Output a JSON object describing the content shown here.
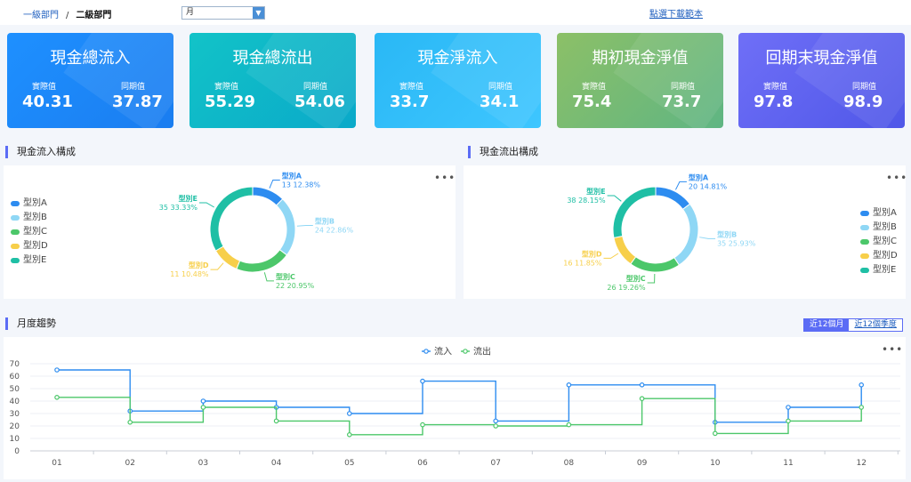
{
  "breadcrumb": {
    "level1": "一級部門",
    "separator": "/",
    "level2": "二級部門"
  },
  "period_select": {
    "value": "月"
  },
  "download_link": "點選下載範本",
  "kpis": [
    {
      "title": "現金總流入",
      "actual_label": "實際值",
      "actual": "40.31",
      "prior_label": "同期值",
      "prior": "37.87",
      "color_from": "#1e90ff",
      "color_to": "#1a7df0"
    },
    {
      "title": "現金總流出",
      "actual_label": "實際值",
      "actual": "55.29",
      "prior_label": "同期值",
      "prior": "54.06",
      "color_from": "#12c3c8",
      "color_to": "#0aa9c9"
    },
    {
      "title": "現金淨流入",
      "actual_label": "實際值",
      "actual": "33.7",
      "prior_label": "同期值",
      "prior": "34.1",
      "color_from": "#2ab8f5",
      "color_to": "#3ec6ff"
    },
    {
      "title": "期初現金淨值",
      "actual_label": "實際值",
      "actual": "75.4",
      "prior_label": "同期值",
      "prior": "73.7",
      "color_from": "#8cc067",
      "color_to": "#5fb583"
    },
    {
      "title": "回期末現金淨值",
      "actual_label": "實際值",
      "actual": "97.8",
      "prior_label": "同期值",
      "prior": "98.9",
      "color_from": "#6f6ff7",
      "color_to": "#4f57e8"
    }
  ],
  "sections": {
    "inflow": "現金流入構成",
    "outflow": "現金流出構成",
    "trend": "月度趨勢"
  },
  "period_tabs": [
    "近12個月",
    "近12個季度"
  ],
  "category_colors": [
    "#2d8cf0",
    "#8fd7f5",
    "#4cc76a",
    "#f7cf4a",
    "#1fbfa5"
  ],
  "chart_data": [
    {
      "type": "pie",
      "id": "inflow",
      "categories": [
        "型別A",
        "型別B",
        "型別C",
        "型別D",
        "型別E"
      ],
      "values": [
        13,
        24,
        22,
        11,
        35
      ],
      "percent_labels": [
        "12.38%",
        "22.86%",
        "20.95%",
        "10.48%",
        "33.33%"
      ],
      "legend_placement": "left"
    },
    {
      "type": "pie",
      "id": "outflow",
      "categories": [
        "型別A",
        "型別B",
        "型別C",
        "型別D",
        "型別E"
      ],
      "values": [
        20,
        35,
        26,
        16,
        38
      ],
      "percent_labels": [
        "14.81%",
        "25.93%",
        "19.26%",
        "11.85%",
        "28.15%"
      ],
      "legend_placement": "right"
    },
    {
      "type": "line",
      "id": "trend",
      "step": true,
      "categories": [
        "01",
        "02",
        "03",
        "04",
        "05",
        "06",
        "07",
        "08",
        "09",
        "10",
        "11",
        "12"
      ],
      "ylim": [
        0,
        70
      ],
      "yticks": [
        0,
        10,
        20,
        30,
        40,
        50,
        60,
        70
      ],
      "legend_placement": "top",
      "series": [
        {
          "name": "流入",
          "color": "#2d8cf0",
          "values": [
            65,
            32,
            40,
            35,
            30,
            56,
            24,
            53,
            53,
            23,
            35,
            53
          ],
          "end_value": 35
        },
        {
          "name": "流出",
          "color": "#4cc76a",
          "values": [
            43,
            23,
            35,
            24,
            13,
            21,
            20,
            21,
            42,
            14,
            24,
            35
          ],
          "end_value": 24
        }
      ]
    }
  ]
}
